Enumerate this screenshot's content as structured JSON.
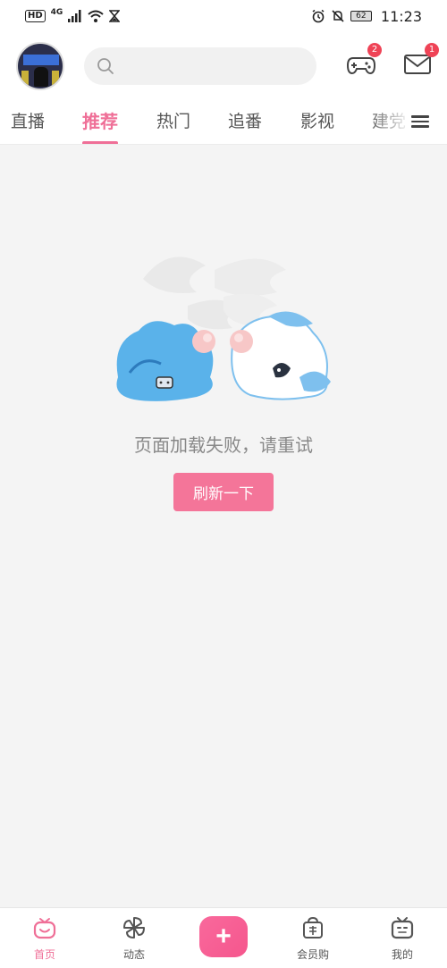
{
  "status_bar": {
    "hd": "HD",
    "network": "4G",
    "battery": "62",
    "time": "11:23",
    "icons": [
      "signal-icon",
      "wifi-icon",
      "hourglass-icon",
      "alarm-icon",
      "mute-bell-icon",
      "battery-icon"
    ]
  },
  "header": {
    "search_placeholder": "",
    "game_badge": "2",
    "mail_badge": "1",
    "icons": [
      "avatar",
      "search-icon",
      "gamepad-icon",
      "mail-icon"
    ]
  },
  "tabs": {
    "items": [
      {
        "label": "直播"
      },
      {
        "label": "推荐",
        "active": true
      },
      {
        "label": "热门"
      },
      {
        "label": "追番"
      },
      {
        "label": "影视"
      },
      {
        "label": "建党"
      }
    ],
    "menu_icon": "hamburger-menu-icon"
  },
  "content": {
    "error_message": "页面加载失败，请重试",
    "retry_label": "刷新一下"
  },
  "bottom_nav": {
    "items": [
      {
        "label": "首页",
        "icon": "home-tv-icon",
        "active": true
      },
      {
        "label": "动态",
        "icon": "pinwheel-icon"
      },
      {
        "label": "+",
        "icon": "plus-icon"
      },
      {
        "label": "会员购",
        "icon": "shopping-bag-icon"
      },
      {
        "label": "我的",
        "icon": "tv-face-icon"
      }
    ]
  },
  "colors": {
    "accent": "#ef6f97",
    "button": "#f47599",
    "badge": "#ef4356",
    "background": "#f4f4f4"
  }
}
